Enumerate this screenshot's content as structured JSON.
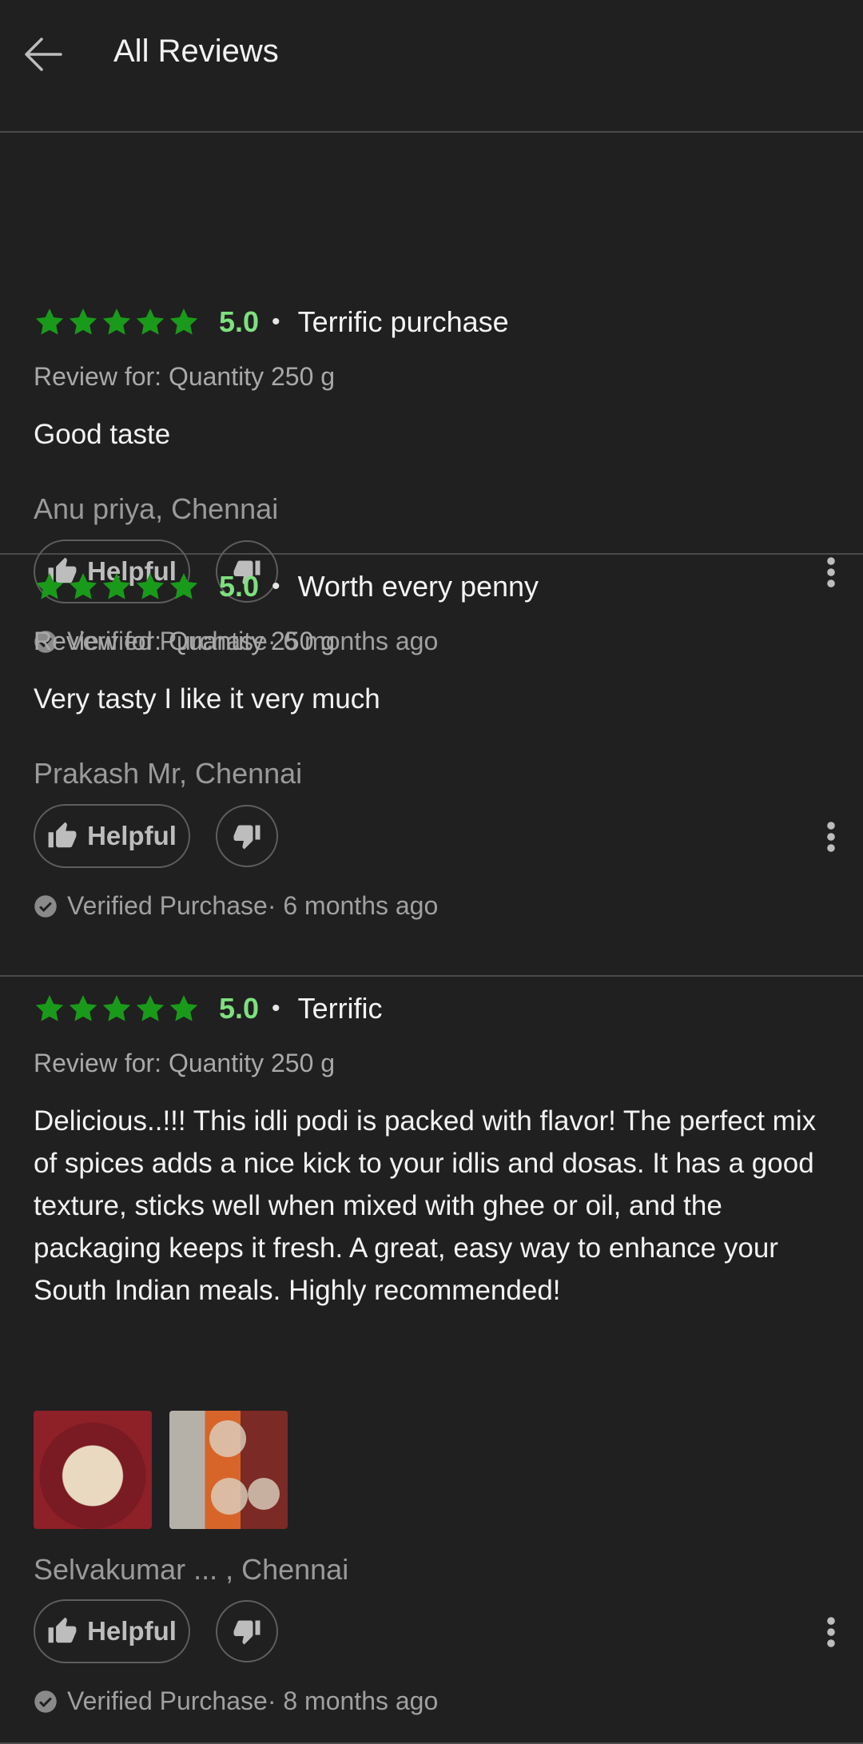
{
  "header": {
    "title": "All Reviews"
  },
  "colors": {
    "star": "#1a9a1a",
    "rating": "#7ee07e",
    "background": "#202020"
  },
  "reviews": [
    {
      "rating": "5.0",
      "stars": 5,
      "title": "Terrific purchase",
      "review_for": "Review for: Quantity 250 g",
      "body": "Good taste",
      "author": "Anu priya, Chennai",
      "helpful_label": "Helpful",
      "verified": "Verified Purchase· 6 months ago"
    },
    {
      "rating": "5.0",
      "stars": 5,
      "title": "Worth every penny",
      "review_for": "Review for: Quantity 250 g",
      "body": "Very tasty I like it very much",
      "author": "Prakash Mr, Chennai",
      "helpful_label": "Helpful",
      "verified": "Verified Purchase· 6 months ago"
    },
    {
      "rating": "5.0",
      "stars": 5,
      "title": "Terrific",
      "review_for": "Review for: Quantity 250 g",
      "body": "Delicious..!!! This idli podi is packed with flavor! The perfect mix of spices adds a nice kick to your idlis and dosas. It has a good texture, sticks well when mixed with ghee or oil, and the packaging keeps it fresh. A great, easy way to enhance your South Indian meals. Highly recommended!",
      "author": "Selvakumar ... , Chennai",
      "helpful_label": "Helpful",
      "verified": "Verified Purchase· 8 months ago"
    }
  ]
}
